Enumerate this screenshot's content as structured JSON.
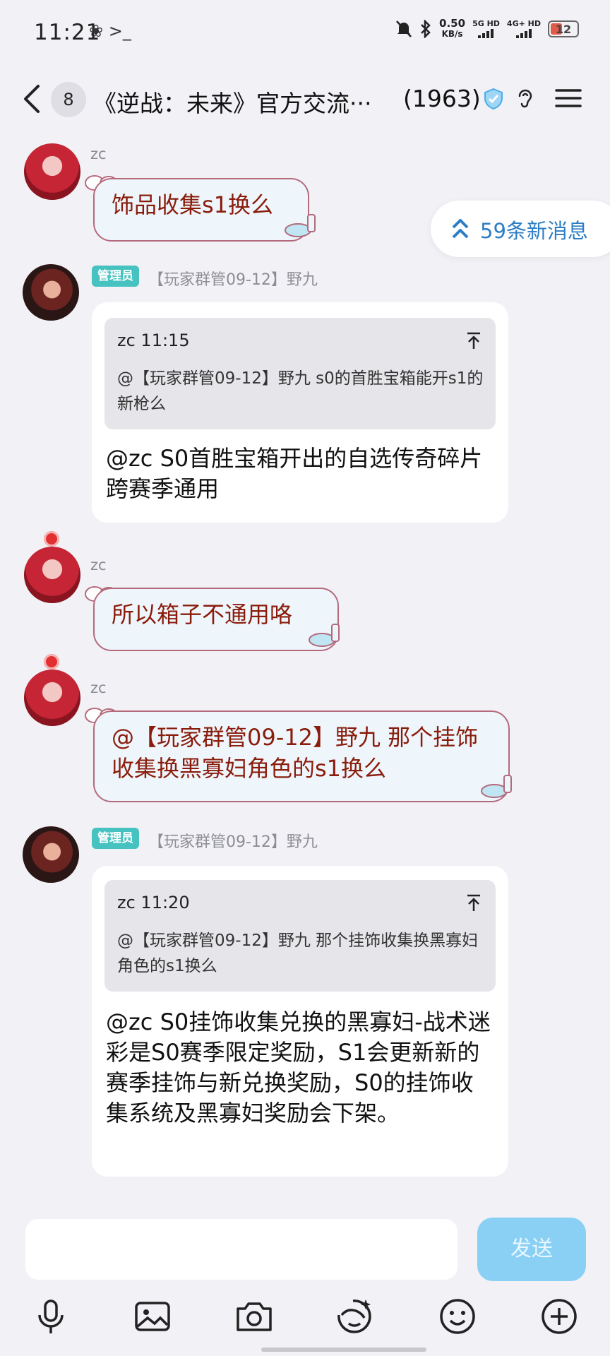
{
  "status_bar": {
    "time": "11:21",
    "app_icons": "❀ >_",
    "net_speed_value": "0.50",
    "net_speed_unit": "KB/s",
    "sim1_label": "5G HD",
    "sim2_label": "4G+ HD",
    "battery": "12"
  },
  "header": {
    "unread_count": "8",
    "title": "《逆战：未来》官方交流···",
    "member_count": "(1963)"
  },
  "new_messages": {
    "label": "59条新消息"
  },
  "messages": [
    {
      "sender": "zc",
      "text": "饰品收集s1换么"
    },
    {
      "role": "管理员",
      "sender": "【玩家群管09-12】野九",
      "quote_head": "zc 11:15",
      "quote_body": "@【玩家群管09-12】野九 s0的首胜宝箱能开s1的新枪么",
      "text": "@zc S0首胜宝箱开出的自选传奇碎片跨赛季通用"
    },
    {
      "sender": "zc",
      "text": "所以箱子不通用咯"
    },
    {
      "sender": "zc",
      "text": "@【玩家群管09-12】野九 那个挂饰收集换黑寡妇角色的s1换么"
    },
    {
      "role": "管理员",
      "sender": "【玩家群管09-12】野九",
      "quote_head": "zc 11:20",
      "quote_body": "@【玩家群管09-12】野九 那个挂饰收集换黑寡妇角色的s1换么",
      "text": "@zc S0挂饰收集兑换的黑寡妇-战术迷彩是S0赛季限定奖励，S1会更新新的赛季挂饰与新兑换奖励，S0的挂饰收集系统及黑寡妇奖励会下架。"
    }
  ],
  "input": {
    "placeholder": "",
    "send_label": "发送"
  },
  "toolbar": [
    "microphone-icon",
    "image-icon",
    "camera-icon",
    "sticker-icon",
    "emoji-icon",
    "plus-icon"
  ],
  "colors": {
    "zc_bubble_text": "#8a1c0c",
    "admin_badge": "#46c2c0",
    "send_button": "#8ad0f5",
    "new_msg_text": "#2b7dc4"
  }
}
